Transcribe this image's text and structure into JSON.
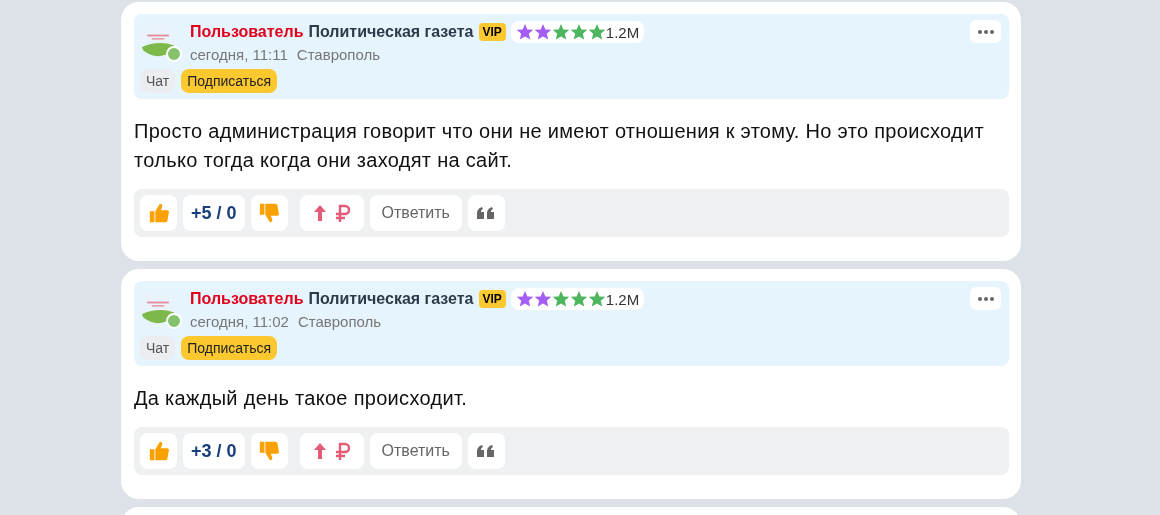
{
  "posts": [
    {
      "author": "Пользователь",
      "publication": "Политическая газета",
      "vip": "VIP",
      "online": true,
      "rating_stars": [
        {
          "color": "#a55ef5"
        },
        {
          "color": "#a55ef5"
        },
        {
          "color": "#4cb55e"
        },
        {
          "color": "#4cb55e"
        },
        {
          "color": "#4cb55e"
        }
      ],
      "rating": "1.2M",
      "time": "сегодня, 11:11",
      "city": "Ставрополь",
      "chat": "Чат",
      "subscribe": "Подписаться",
      "text": "Просто администрация говорит что они не имеют отношения к этому. Но это происходит только тогда когда они заходят на сайт.",
      "score": "+5 / 0",
      "reply": "Ответить"
    },
    {
      "author": "Пользователь",
      "publication": "Политическая газета",
      "vip": "VIP",
      "online": true,
      "rating_stars": [
        {
          "color": "#a55ef5"
        },
        {
          "color": "#a55ef5"
        },
        {
          "color": "#4cb55e"
        },
        {
          "color": "#4cb55e"
        },
        {
          "color": "#4cb55e"
        }
      ],
      "rating": "1.2M",
      "time": "сегодня, 11:02",
      "city": "Ставрополь",
      "chat": "Чат",
      "subscribe": "Подписаться",
      "text": "Да каждый день такое происходит.",
      "score": "+3 / 0",
      "reply": "Ответить"
    }
  ]
}
